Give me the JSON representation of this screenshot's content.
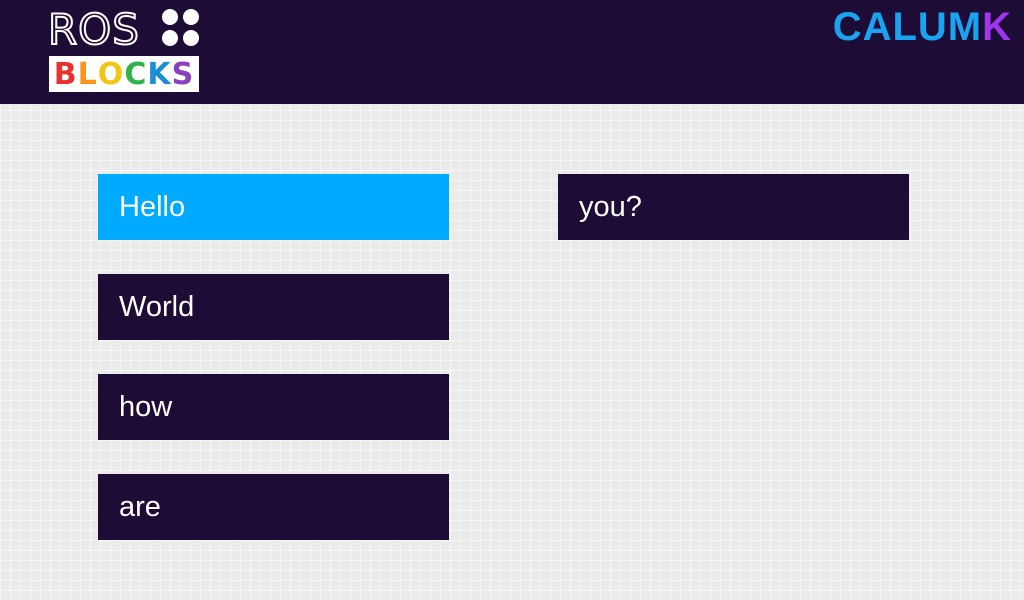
{
  "header": {
    "logo": {
      "line1": "ROS",
      "line2_letters": [
        {
          "char": "B",
          "color": "#e8322f"
        },
        {
          "char": "L",
          "color": "#f7941d"
        },
        {
          "char": "O",
          "color": "#f2c514"
        },
        {
          "char": "C",
          "color": "#2fb34a"
        },
        {
          "char": "K",
          "color": "#1c8fd4"
        },
        {
          "char": "S",
          "color": "#8a3fbf"
        }
      ]
    },
    "brand": [
      {
        "text": "CALUM",
        "color": "#1aa3f0"
      },
      {
        "text": "K",
        "color": "#a035f0"
      }
    ]
  },
  "blocks": [
    {
      "label": "Hello",
      "active": true
    },
    {
      "label": "World",
      "active": false
    },
    {
      "label": "how",
      "active": false
    },
    {
      "label": "are",
      "active": false
    },
    {
      "label": "you?",
      "active": false
    }
  ],
  "colors": {
    "header_bg": "#1d0c35",
    "block_bg": "#1d0c35",
    "active_block_bg": "#00aaff",
    "page_bg": "#ebebeb"
  }
}
